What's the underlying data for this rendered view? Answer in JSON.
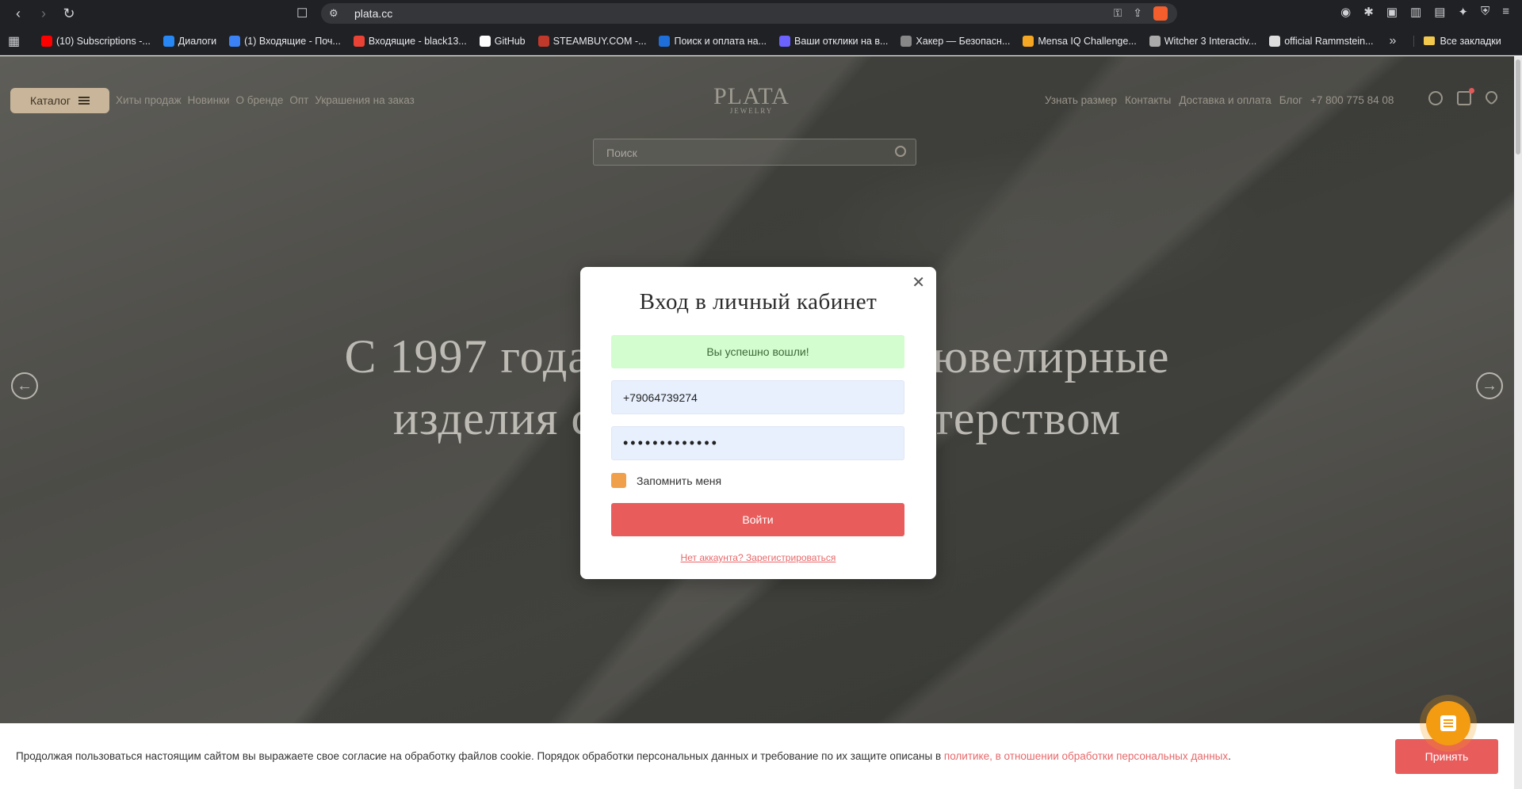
{
  "browser": {
    "url": "plata.cc",
    "bookmarks": [
      {
        "label": "(10) Subscriptions -...",
        "color": "#ff0000"
      },
      {
        "label": "Диалоги",
        "color": "#2787f5"
      },
      {
        "label": "(1) Входящие - Поч...",
        "color": "#3b82f6"
      },
      {
        "label": "Входящие - black13...",
        "color": "#ea4335"
      },
      {
        "label": "GitHub",
        "color": "#ffffff"
      },
      {
        "label": "STEAMBUY.COM -...",
        "color": "#c0392b"
      },
      {
        "label": "Поиск и оплата на...",
        "color": "#1e6fd9"
      },
      {
        "label": "Ваши отклики на в...",
        "color": "#6c63ff"
      },
      {
        "label": "Хакер — Безопасн...",
        "color": "#888888"
      },
      {
        "label": "Mensa IQ Challenge...",
        "color": "#f5a623"
      },
      {
        "label": "Witcher 3 Interactiv...",
        "color": "#aaaaaa"
      },
      {
        "label": "official Rammstein...",
        "color": "#dddddd"
      }
    ],
    "bookmarks_more": "»",
    "all_bookmarks": "Все закладки"
  },
  "site": {
    "catalog_label": "Каталог",
    "nav_left": [
      "Хиты продаж",
      "Новинки",
      "О бренде",
      "Опт",
      "Украшения на заказ"
    ],
    "logo": "PLATA",
    "logo_sub": "JEWELRY",
    "nav_right": [
      "Узнать размер",
      "Контакты",
      "Доставка и оплата",
      "Блог",
      "+7 800 775 84 08"
    ],
    "search_placeholder": "Поиск",
    "hero_line1": "С 1997 года                           ювелирные",
    "hero_line2": "изделия с                         стерством"
  },
  "modal": {
    "title": "Вход в личный кабинет",
    "success": "Вы успешно вошли!",
    "phone": "+79064739274",
    "password_mask": "•••••••••••••",
    "remember": "Запомнить меня",
    "submit": "Войти",
    "register": "Нет аккаунта? Зарегистрироваться"
  },
  "cookie": {
    "text": "Продолжая пользоваться настоящим сайтом вы выражаете свое согласие на обработку файлов cookie. Порядок обработки персональных данных и требование по их защите описаны в ",
    "link": "политике, в отношении обработки персональных данных",
    "tail": ".",
    "accept": "Принять"
  }
}
